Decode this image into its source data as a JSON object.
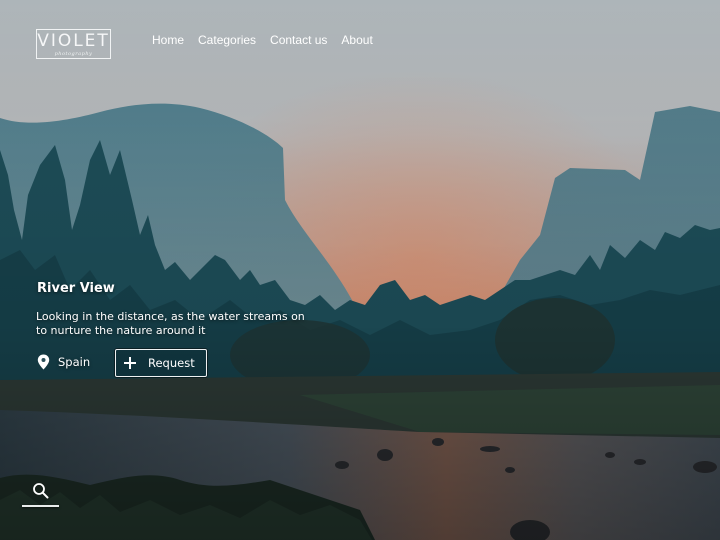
{
  "brand": {
    "name": "VIOLET",
    "tagline": "photography"
  },
  "nav": {
    "items": [
      {
        "label": "Home"
      },
      {
        "label": "Categories"
      },
      {
        "label": "Contact us"
      },
      {
        "label": "About"
      }
    ]
  },
  "hero": {
    "title": "River View",
    "description": "Looking in the distance, as the water streams on to nurture the nature around it",
    "location": {
      "icon": "map-pin-icon",
      "label": "Spain"
    },
    "request_button": {
      "icon": "plus-icon",
      "label": "Request"
    },
    "background_image": "misty mountain valley with pine forest and river at dusk"
  },
  "search": {
    "icon": "search-icon"
  },
  "colors": {
    "text": "#ffffff",
    "sky_top": "#b3b8bb",
    "sky_glow": "#d98c6a",
    "mountain": "#4e7d8c",
    "forest": "#1e4c57",
    "water": "#4a5560"
  }
}
